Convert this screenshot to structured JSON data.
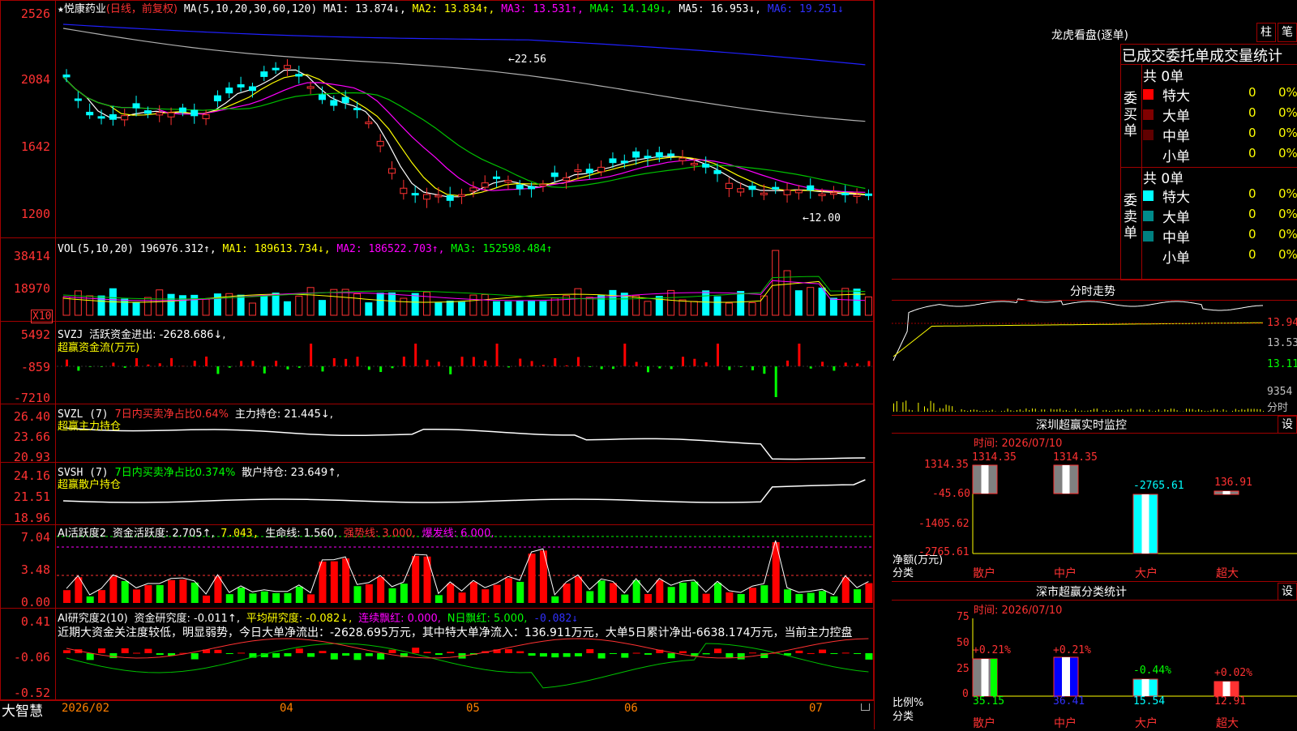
{
  "stock": {
    "name": "悦康药业",
    "period_tag": "(日线，前复权)",
    "ma_label": "MA(5,10,20,30,60,120)",
    "ma1": "MA1: 13.874↓,",
    "ma2": "MA2: 13.834↑,",
    "ma3": "MA3: 13.531↑,",
    "ma4": "MA4: 14.149↓,",
    "ma5": "MA5: 16.953↓,",
    "ma6": "MA6: 19.251↓"
  },
  "price_axis": [
    "2526",
    "2084",
    "1642",
    "1200"
  ],
  "price_marks": {
    "high": "←22.56",
    "low": "←12.00"
  },
  "vol": {
    "label": "VOL(5,10,20)",
    "value": "196976.312↑,",
    "ma1": "MA1: 189613.734↓,",
    "ma2": "MA2: 186522.703↑,",
    "ma3": "MA3: 152598.484↑",
    "axis": [
      "38414",
      "18970"
    ],
    "unit": "X10"
  },
  "svzj": {
    "label": "SVZJ",
    "desc": "活跃资金进出: -2628.686↓,",
    "sub": "超赢资金流(万元)",
    "axis": [
      "5492",
      "-859",
      "-7210"
    ]
  },
  "svzl": {
    "label": "SVZL (7)",
    "desc1": "7日内买卖净占比0.64%",
    "desc2": "主力持仓: 21.445↓,",
    "sub": "超赢主力持仓",
    "axis": [
      "26.40",
      "23.66",
      "20.93"
    ]
  },
  "svsh": {
    "label": "SVSH (7)",
    "desc1": "7日内买卖净占比0.374%",
    "desc2": "散户持仓: 23.649↑,",
    "sub": "超赢散户持仓",
    "axis": [
      "24.16",
      "21.51",
      "18.96"
    ]
  },
  "ai_hy": {
    "label": "AI活跃度2",
    "v1": "资金活跃度: 2.705↑,",
    "v2": "7.043,",
    "v3": "生命线: 1.560,",
    "v4": "强势线: 3.000,",
    "v5": "爆发线: 6.000,",
    "axis": [
      "7.04",
      "3.48",
      "0.00"
    ]
  },
  "ai_yj": {
    "label": "AI研究度2(10)",
    "v1": "资金研究度: -0.011↑,",
    "v2": "平均研究度: -0.082↓,",
    "v3": "连续飘红: 0.000,",
    "v4": "N日飘红: 5.000,",
    "v5": "-0.082↓",
    "text": "近期大资金关注度较低，明显弱势，今日大单净流出：-2628.695万元，其中特大单净流入：136.911万元，大单5日累计净出-6638.174万元，当前主力控盘",
    "axis": [
      "0.41",
      "-0.06",
      "-0.52"
    ]
  },
  "x_axis": {
    "brand": "大智慧",
    "labels": [
      "2026/02",
      "04",
      "05",
      "06",
      "07"
    ]
  },
  "right": {
    "lhb_title": "龙虎看盘(逐单)",
    "tab1": "柱",
    "tab2": "笔",
    "stats_title": "已成交委托单成交量统计",
    "buy": {
      "side": "委买单",
      "total": "共 0单",
      "rows": [
        {
          "name": "特大",
          "v": "0",
          "p": "0%"
        },
        {
          "name": "大单",
          "v": "0",
          "p": "0%"
        },
        {
          "name": "中单",
          "v": "0",
          "p": "0%"
        },
        {
          "name": "小单",
          "v": "0",
          "p": "0%"
        }
      ]
    },
    "sell": {
      "side": "委卖单",
      "total": "共 0单",
      "rows": [
        {
          "name": "特大",
          "v": "0",
          "p": "0%"
        },
        {
          "name": "大单",
          "v": "0",
          "p": "0%"
        },
        {
          "name": "中单",
          "v": "0",
          "p": "0%"
        },
        {
          "name": "小单",
          "v": "0",
          "p": "0%"
        }
      ]
    },
    "intraday": {
      "title": "分时走势",
      "axis": [
        "13.94",
        "13.53",
        "13.11"
      ],
      "vol": "9354",
      "unit": "分时"
    },
    "monitor": {
      "title": "深圳超赢实时监控",
      "settings": "设",
      "time": "时间: 2026/07/10",
      "axis": [
        "1314.35",
        "-45.60",
        "-1405.62",
        "-2765.61"
      ],
      "ylabel": "净额(万元)",
      "xlabel": "分类",
      "cats": [
        "散户",
        "中户",
        "大户",
        "超大"
      ],
      "vals": [
        "1314.35",
        "1314.35",
        "-2765.61",
        "136.91"
      ]
    },
    "classstat": {
      "title": "深市超赢分类统计",
      "settings": "设",
      "time": "时间: 2026/07/10",
      "axis": [
        "75",
        "50",
        "25",
        "0"
      ],
      "ylabel": "比例%",
      "xlabel": "分类",
      "cats": [
        "散户",
        "中户",
        "大户",
        "超大"
      ],
      "top": [
        "+0.21%",
        "+0.21%",
        "-0.44%",
        "+0.02%"
      ],
      "vals": [
        "35.15",
        "36.41",
        "15.54",
        "12.91"
      ]
    }
  }
}
